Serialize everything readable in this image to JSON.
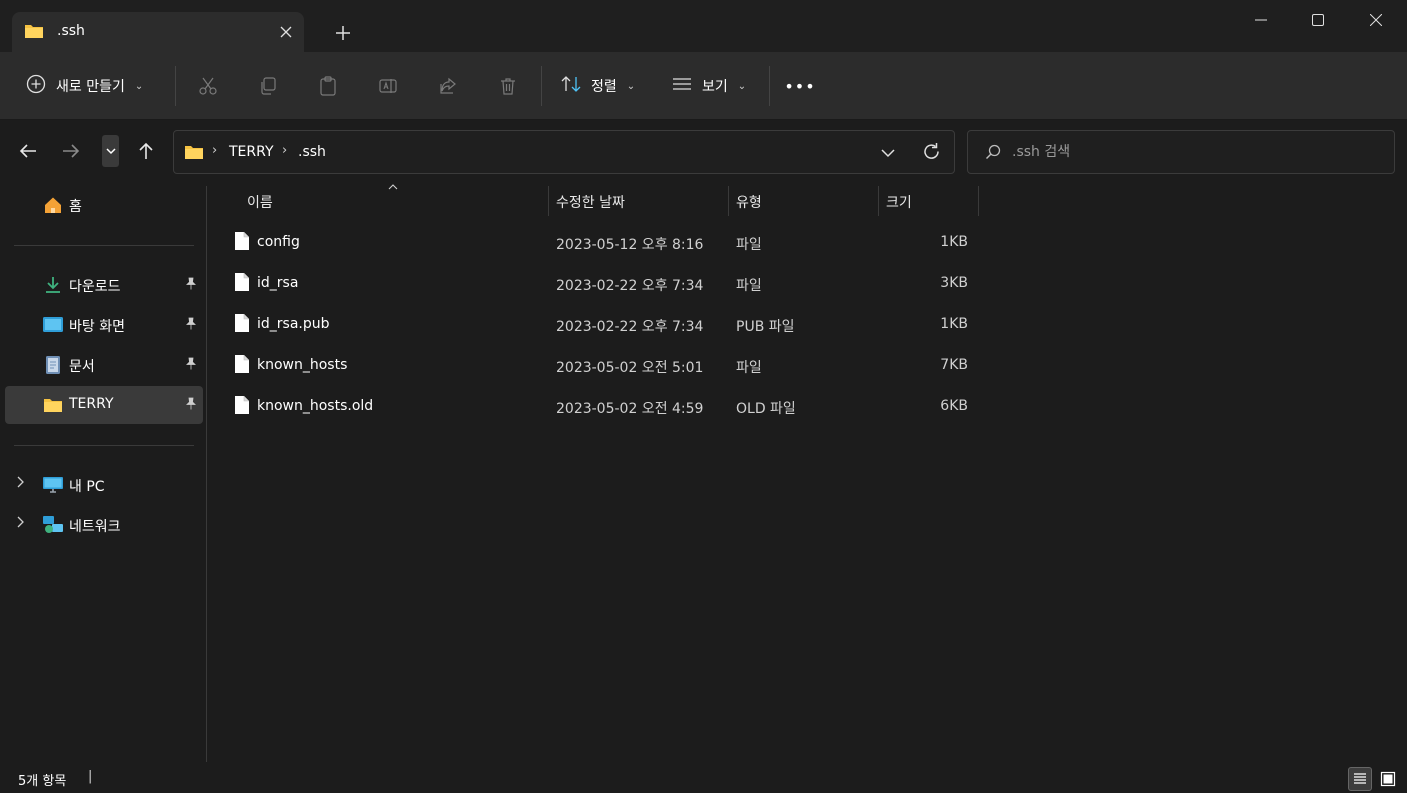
{
  "window": {
    "tab_title": ".ssh",
    "new_tab_label": "+"
  },
  "commandbar": {
    "new_label": "새로 만들기",
    "sort_label": "정렬",
    "view_label": "보기",
    "more_label": "•••"
  },
  "address": {
    "crumbs": [
      "TERRY",
      ".ssh"
    ],
    "search_placeholder": ".ssh 검색"
  },
  "sidebar": {
    "home": "홈",
    "quick": [
      {
        "label": "다운로드",
        "icon": "download-icon",
        "pinned": true
      },
      {
        "label": "바탕 화면",
        "icon": "desktop-icon",
        "pinned": true
      },
      {
        "label": "문서",
        "icon": "document-icon",
        "pinned": true
      },
      {
        "label": "TERRY",
        "icon": "folder-icon",
        "pinned": true,
        "active": true
      }
    ],
    "devices": [
      {
        "label": "내 PC",
        "icon": "pc-icon"
      },
      {
        "label": "네트워크",
        "icon": "network-icon"
      }
    ]
  },
  "columns": {
    "name": "이름",
    "date": "수정한 날짜",
    "type": "유형",
    "size": "크기"
  },
  "files": [
    {
      "name": "config",
      "date": "2023-05-12 오후 8:16",
      "type": "파일",
      "size": "1KB"
    },
    {
      "name": "id_rsa",
      "date": "2023-02-22 오후 7:34",
      "type": "파일",
      "size": "3KB"
    },
    {
      "name": "id_rsa.pub",
      "date": "2023-02-22 오후 7:34",
      "type": "PUB 파일",
      "size": "1KB"
    },
    {
      "name": "known_hosts",
      "date": "2023-05-02 오전 5:01",
      "type": "파일",
      "size": "7KB"
    },
    {
      "name": "known_hosts.old",
      "date": "2023-05-02 오전 4:59",
      "type": "OLD 파일",
      "size": "6KB"
    }
  ],
  "status": {
    "item_count": "5개 항목",
    "separator": "|"
  },
  "colors": {
    "folder": "#f5c242",
    "accent_blue": "#4fc3f7",
    "download_green": "#3fb27f"
  }
}
